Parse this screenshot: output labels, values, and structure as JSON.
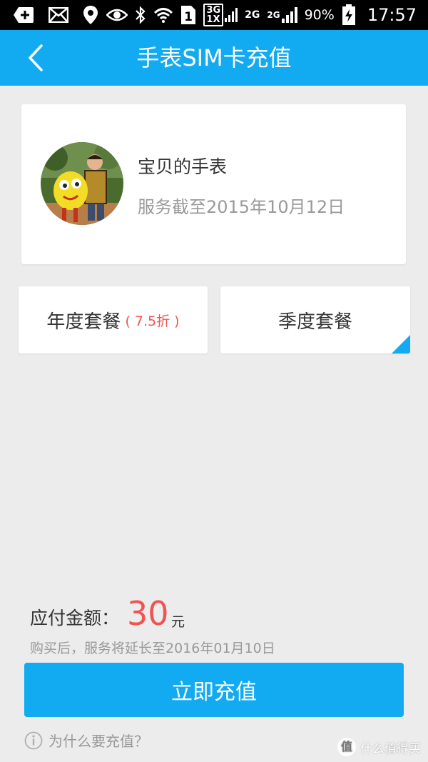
{
  "status_bar": {
    "net_badge_3g_top": "3G",
    "net_badge_3g_bottom": "1X",
    "net_2g_top": "2G",
    "net_2g_small": "2G",
    "sim_slot": "1",
    "battery_percent": "90%",
    "time": "17:57"
  },
  "app_bar": {
    "title": "手表SIM卡充值"
  },
  "profile": {
    "name": "宝贝的手表",
    "service_until": "服务截至2015年10月12日"
  },
  "plans": [
    {
      "label": "年度套餐",
      "discount": "( 7.5折 )",
      "selected": false
    },
    {
      "label": "季度套餐",
      "discount": "",
      "selected": true
    }
  ],
  "payment": {
    "label": "应付金额：",
    "amount": "30",
    "unit": "元",
    "note": "购买后，服务将延长至2016年01月10日"
  },
  "actions": {
    "recharge_label": "立即充值",
    "why_label": "为什么要充值？"
  },
  "watermark": {
    "logo_char": "值",
    "text": "什么值得买"
  },
  "colors": {
    "accent": "#12aaf0",
    "price_red": "#f05450",
    "background": "#ececed"
  }
}
